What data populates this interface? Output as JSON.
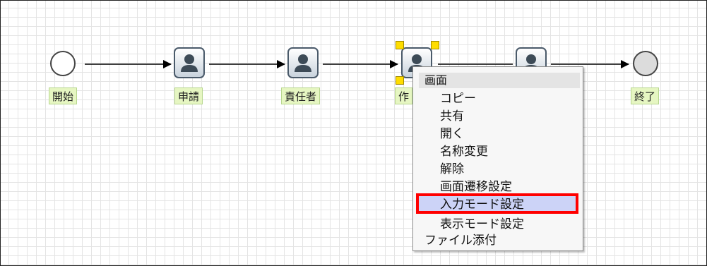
{
  "nodes": {
    "start_label": "開始",
    "apply_label": "申請",
    "manager_label": "責任者",
    "creator_label": "作",
    "end_label": "終了"
  },
  "context_menu": {
    "header": "画面",
    "items": [
      "コピー",
      "共有",
      "開く",
      "名称変更",
      "解除",
      "画面遷移設定"
    ],
    "highlighted": "入力モード設定",
    "after_items": [
      "表示モード設定"
    ],
    "attachment": "ファイル添付"
  },
  "colors": {
    "highlight_border": "#ff0000",
    "highlight_fill": "#ccd3f7",
    "label_bg": "#e6f6c2",
    "handle": "#ffdd00"
  }
}
